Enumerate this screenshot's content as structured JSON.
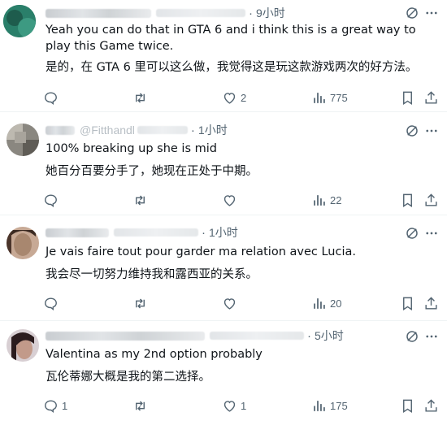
{
  "colors": {
    "text": "#0f1419",
    "muted": "#536471",
    "divider": "#eff3f4"
  },
  "replies": [
    {
      "time": "9小时",
      "text": "Yeah you can do that in GTA 6 and i think this is a great way to play this Game twice.",
      "translation": "是的，在 GTA 6 里可以这么做，我觉得这是玩这款游戏两次的好方法。",
      "replies_count": "",
      "reposts_count": "",
      "likes_count": "2",
      "views_count": "775"
    },
    {
      "handle_partial": "@Fitthandl",
      "time": "1小时",
      "text": "100% breaking up she is mid",
      "translation": "她百分百要分手了，她现在正处于中期。",
      "replies_count": "",
      "reposts_count": "",
      "likes_count": "",
      "views_count": "22"
    },
    {
      "time": "1小时",
      "text": "Je vais faire tout pour garder ma relation avec Lucia.",
      "translation": "我会尽一切努力维持我和露西亚的关系。",
      "replies_count": "",
      "reposts_count": "",
      "likes_count": "",
      "views_count": "20"
    },
    {
      "time": "5小时",
      "text": "Valentina as my 2nd option probably",
      "translation": "瓦伦蒂娜大概是我的第二选择。",
      "replies_count": "1",
      "reposts_count": "",
      "likes_count": "1",
      "views_count": "175"
    }
  ]
}
